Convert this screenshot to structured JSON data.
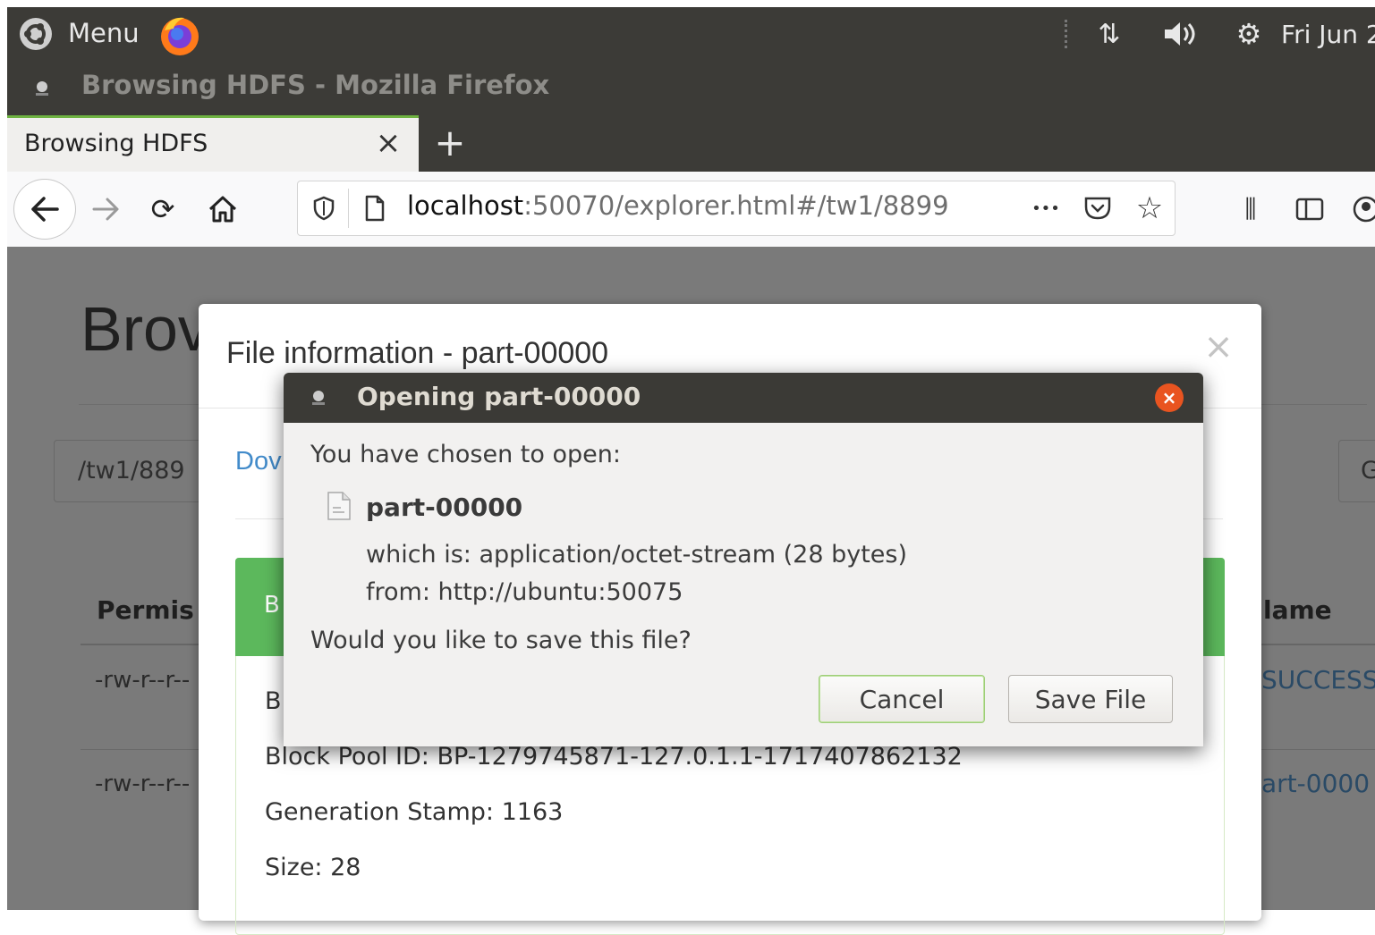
{
  "desktop": {
    "menu_label": "Menu",
    "clock": "Fri Jun 2"
  },
  "window": {
    "title": "Browsing HDFS - Mozilla Firefox"
  },
  "tab": {
    "title": "Browsing HDFS",
    "close_glyph": "×",
    "new_tab_glyph": "+"
  },
  "urlbar": {
    "host": "localhost",
    "path": ":50070/explorer.html#/tw1/8899",
    "more_glyph": "•••"
  },
  "page": {
    "heading": "Brov",
    "path_input": "/tw1/889",
    "go_button_partial": "G",
    "download_partial": "Dov",
    "permission_header": "Permis",
    "name_header": "lame",
    "rows": [
      {
        "permission": "-rw-r--r--",
        "name": "SUCCESS"
      },
      {
        "permission": "-rw-r--r--",
        "name": "art-0000"
      }
    ]
  },
  "modal": {
    "title": "File information - part-00000",
    "close_glyph": "×",
    "green_bar_letter": "B",
    "body_line_partial": "B",
    "block_pool": "Block Pool ID: BP-1279745871-127.0.1.1-1717407862132",
    "generation_stamp": "Generation Stamp: 1163",
    "size": "Size: 28"
  },
  "dialog": {
    "title": "Opening part-00000",
    "prompt": "You have chosen to open:",
    "filename": "part-00000",
    "which_is": "which is: application/octet-stream (28 bytes)",
    "from": "from: http://ubuntu:50075",
    "question": "Would you like to save this file?",
    "cancel_label": "Cancel",
    "save_label": "Save File"
  },
  "colors": {
    "panel": "#3c3b37",
    "accent_green": "#6fb342",
    "bootstrap_green": "#5cb85c",
    "link_blue": "#428bca",
    "close_orange": "#e95420"
  }
}
